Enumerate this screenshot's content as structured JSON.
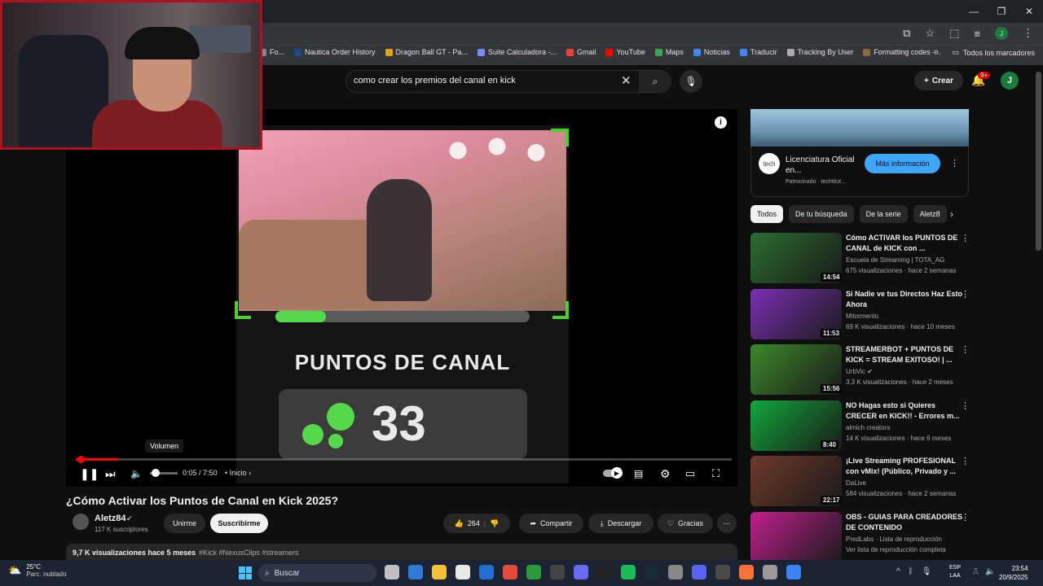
{
  "browser": {
    "window_controls": [
      "—",
      "❐",
      "✕"
    ],
    "bookmarks": [
      {
        "label": "Fo...",
        "color": "#888888"
      },
      {
        "label": "Nautica Order History",
        "color": "#1a4b8c"
      },
      {
        "label": "Dragon Ball GT - Pa...",
        "color": "#e3a21a"
      },
      {
        "label": "Suite Calculadora -...",
        "color": "#7a8cff"
      },
      {
        "label": "Gmail",
        "color": "#ea4335"
      },
      {
        "label": "YouTube",
        "color": "#ff0000"
      },
      {
        "label": "Maps",
        "color": "#34a853"
      },
      {
        "label": "Noticias",
        "color": "#4285f4"
      },
      {
        "label": "Traducir",
        "color": "#4285f4"
      },
      {
        "label": "Tracking By User",
        "color": "#aaaaaa"
      },
      {
        "label": "Formatting codes -...",
        "color": "#8a6d3b"
      }
    ],
    "bookmarks_more": "»",
    "all_bookmarks": "Todos los marcadores",
    "profile_initial": "J"
  },
  "header": {
    "search_query": "como crear los premios del canal en kick",
    "create_label": "Crear",
    "notifications_badge": "9+",
    "avatar_initial": "J"
  },
  "video_overlay": {
    "heading": "PUNTOS DE CANAL",
    "points_value": "33",
    "progress_fraction": 0.2
  },
  "player": {
    "volume_tooltip": "Volumen",
    "time": "0:05 / 7:50",
    "chapter": "• Inicio",
    "chapter_arrow": "›",
    "played_fraction": 0.065,
    "volume_fraction": 0.1
  },
  "video": {
    "title": "¿Cómo Activar los Puntos de Canal en Kick 2025?",
    "channel": "Aletz84",
    "subscribers": "117 K suscriptores",
    "join_label": "Unirme",
    "subscribe_label": "Suscribirme",
    "likes": "264",
    "share_label": "Compartir",
    "download_label": "Descargar",
    "thanks_label": "Gracias",
    "views_date": "9,7 K visualizaciones  hace 5 meses",
    "tags": "#Kick #NexusClips #streamers"
  },
  "ad": {
    "logo_text": "tech",
    "title": "Licenciatura Oficial en...",
    "sponsor": "Patrocinado · techtitut...",
    "cta": "Más información"
  },
  "chips": [
    "Todos",
    "De tu búsqueda",
    "De la serie",
    "Aletz8"
  ],
  "recommendations": [
    {
      "title": "Cómo ACTIVAR los PUNTOS DE CANAL de KICK con ...",
      "channel": "Escuela de Streaming | TOTA_AG",
      "meta": "675 visualizaciones · hace 2 semanas",
      "duration": "14:54",
      "color": "#2b6e2f"
    },
    {
      "title": "Si Nadie ve tus Directos Haz Esto Ahora",
      "channel": "Mitormento",
      "meta": "69 K visualizaciones · hace 10 meses",
      "duration": "11:53",
      "color": "#7b2fb5"
    },
    {
      "title": "STREAMERBOT + PUNTOS DE KICK = STREAM EXITOSO! | ...",
      "channel": "UrbVic ✔",
      "meta": "3,3 K visualizaciones · hace 2 meses",
      "duration": "15:56",
      "color": "#3c8a2a"
    },
    {
      "title": "NO Hagas esto si Quieres CRECER en KICK!! - Errores m...",
      "channel": "almich creators",
      "meta": "14 K visualizaciones · hace 6 meses",
      "duration": "8:40",
      "color": "#11a83a"
    },
    {
      "title": "¡Live Streaming PROFESIONAL con vMix! (Público, Privado y ...",
      "channel": "DaLive",
      "meta": "584 visualizaciones · hace 2 semanas",
      "duration": "22:17",
      "color": "#6e3a2a"
    },
    {
      "title": "OBS - GUIAS PARA CREADORES DE CONTENIDO",
      "channel": "PredLabs · Lista de reproducción",
      "meta": "Ver lista de reproducción completa",
      "duration": "",
      "color": "#c21f8f"
    }
  ],
  "taskbar": {
    "temperature": "25°C",
    "condition": "Parc. nublado",
    "search_label": "Buscar",
    "language": "ESP\nLAA",
    "time": "23:54",
    "date": "20/9/2025",
    "apps": [
      "#c0c0c0",
      "#2f7bd8",
      "#f3c03a",
      "#e8e8e8",
      "#1f6fd1",
      "#e34b3b",
      "#2a9a3a",
      "#444444",
      "#6a6af0",
      "#222222",
      "#1db954",
      "#1b2838",
      "#888888",
      "#5865f2",
      "#4a4a4a",
      "#ff7139",
      "#9a9a9a",
      "#3b82f6"
    ]
  }
}
